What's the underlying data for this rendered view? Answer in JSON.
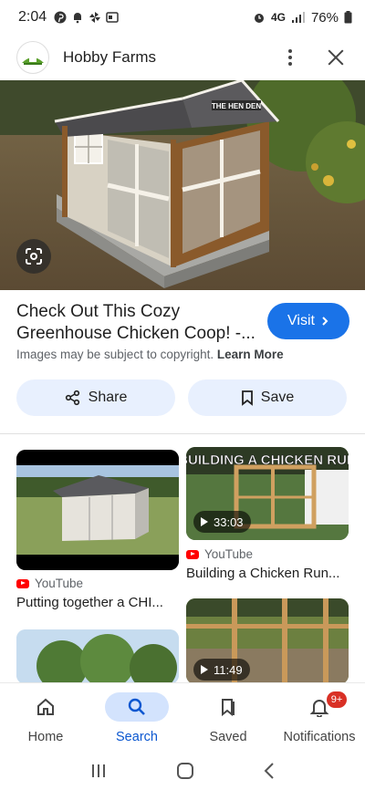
{
  "status_bar": {
    "time": "2:04",
    "network": "4G",
    "battery": "76%"
  },
  "header": {
    "site_name": "Hobby Farms"
  },
  "hero": {
    "sign_text": "THE HEN DEN"
  },
  "result": {
    "title": "Check Out This Cozy Greenhouse Chicken Coop! -...",
    "visit_label": "Visit",
    "copyright_text": "Images may be subject to copyright.",
    "learn_more": "Learn More",
    "share_label": "Share",
    "save_label": "Save"
  },
  "related": [
    {
      "source": "YouTube",
      "title": "Putting together a CHI...",
      "duration": ""
    },
    {
      "source": "YouTube",
      "title": "Building a Chicken Run...",
      "duration": "33:03",
      "overlay_text": "BUILDING A CHICKEN RUN"
    },
    {
      "source": "",
      "title": "",
      "duration": ""
    },
    {
      "source": "",
      "title": "",
      "duration": "11:49"
    }
  ],
  "bottom_nav": [
    {
      "label": "Home",
      "icon": "home-icon"
    },
    {
      "label": "Search",
      "icon": "search-icon",
      "active": true
    },
    {
      "label": "Saved",
      "icon": "bookmark-icon"
    },
    {
      "label": "Notifications",
      "icon": "bell-icon",
      "badge": "9+"
    }
  ],
  "colors": {
    "accent": "#1a73e8",
    "chip_bg": "#e8f0fe",
    "active_nav": "#d3e3fd",
    "badge": "#d93025"
  }
}
